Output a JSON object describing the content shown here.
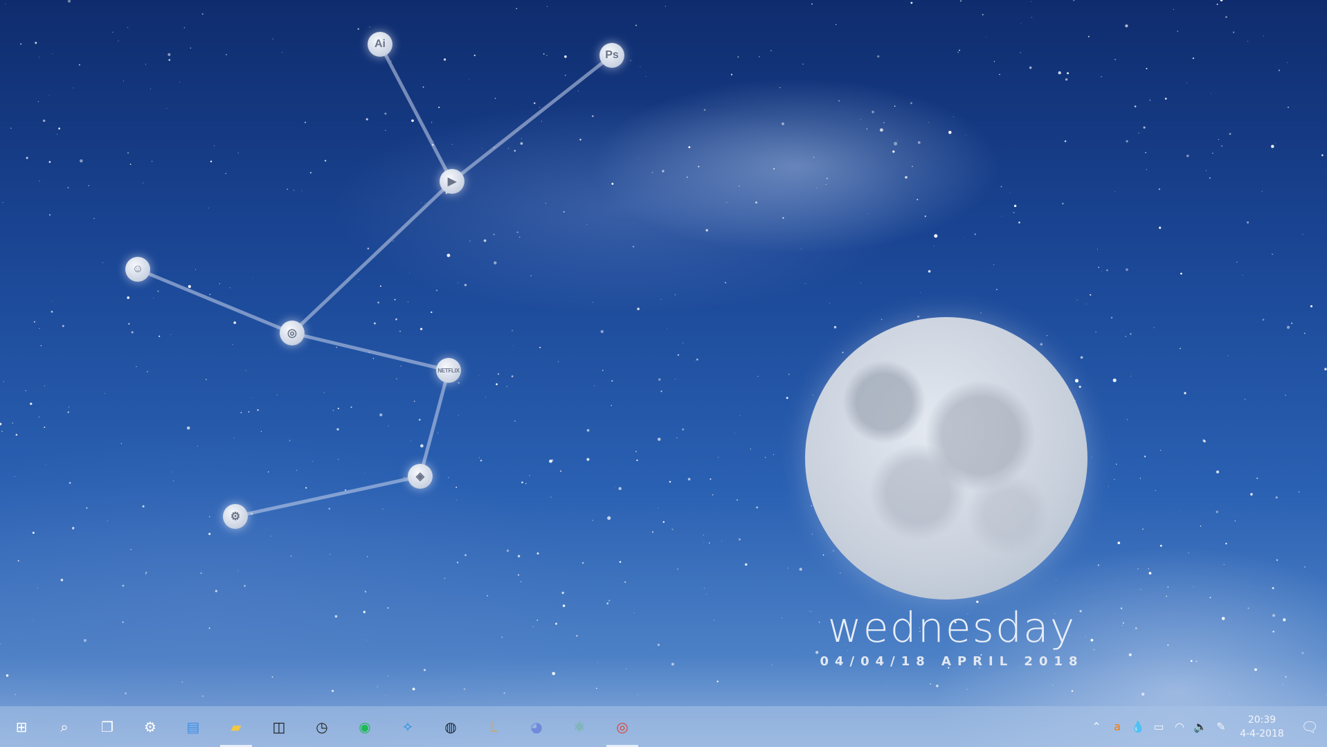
{
  "desktop": {
    "constellation": [
      {
        "id": "illustrator",
        "label": "Ai",
        "icon": "adobe-illustrator-icon"
      },
      {
        "id": "photoshop",
        "label": "Ps",
        "icon": "adobe-photoshop-icon"
      },
      {
        "id": "youtube",
        "label": "▶",
        "icon": "youtube-icon"
      },
      {
        "id": "reddit",
        "label": "☺",
        "icon": "reddit-icon"
      },
      {
        "id": "chrome",
        "label": "◎",
        "icon": "chrome-icon"
      },
      {
        "id": "netflix",
        "label": "NETFLIX",
        "icon": "netflix-icon"
      },
      {
        "id": "overwatch",
        "label": "◈",
        "icon": "overwatch-icon"
      },
      {
        "id": "steam",
        "label": "⚙",
        "icon": "steam-icon"
      }
    ],
    "day_name": "wednesday",
    "date_line": "04/04/18 APRIL 2018"
  },
  "taskbar": {
    "apps": [
      {
        "name": "start",
        "icon": "windows-logo-icon",
        "glyph": "⊞"
      },
      {
        "name": "search",
        "icon": "search-icon",
        "glyph": "⌕"
      },
      {
        "name": "task-view",
        "icon": "task-view-icon",
        "glyph": "❐"
      },
      {
        "name": "settings",
        "icon": "gear-icon",
        "glyph": "⚙"
      },
      {
        "name": "contacts",
        "icon": "contact-card-icon",
        "glyph": "▤"
      },
      {
        "name": "file-explorer",
        "icon": "folder-icon",
        "glyph": "▰"
      },
      {
        "name": "dolby",
        "icon": "dolby-icon",
        "glyph": "◫"
      },
      {
        "name": "clock",
        "icon": "clock-icon",
        "glyph": "◷"
      },
      {
        "name": "spotify",
        "icon": "spotify-icon",
        "glyph": "◉"
      },
      {
        "name": "battle-net",
        "icon": "battle-net-icon",
        "glyph": "✧"
      },
      {
        "name": "steam",
        "icon": "steam-icon",
        "glyph": "◍"
      },
      {
        "name": "league-of-legends",
        "icon": "league-of-legends-icon",
        "glyph": "L"
      },
      {
        "name": "discord",
        "icon": "discord-icon",
        "glyph": "◕"
      },
      {
        "name": "atom",
        "icon": "atom-icon",
        "glyph": "⚛"
      },
      {
        "name": "chrome",
        "icon": "chrome-icon",
        "glyph": "◎"
      }
    ],
    "active_apps": [
      "file-explorer",
      "chrome"
    ],
    "tray": {
      "icons": [
        {
          "name": "show-hidden-icons",
          "icon": "chevron-up-icon",
          "glyph": "⌃"
        },
        {
          "name": "avast",
          "icon": "avast-icon",
          "glyph": "a"
        },
        {
          "name": "droplet",
          "icon": "droplet-icon",
          "glyph": "💧"
        },
        {
          "name": "battery",
          "icon": "battery-icon",
          "glyph": "▭"
        },
        {
          "name": "wifi",
          "icon": "wifi-icon",
          "glyph": "◠"
        },
        {
          "name": "volume",
          "icon": "volume-icon",
          "glyph": "🔈"
        },
        {
          "name": "pen",
          "icon": "pen-icon",
          "glyph": "✎"
        }
      ],
      "time": "20:39",
      "date": "4-4-2018",
      "notifications_icon": "action-center-icon"
    }
  }
}
